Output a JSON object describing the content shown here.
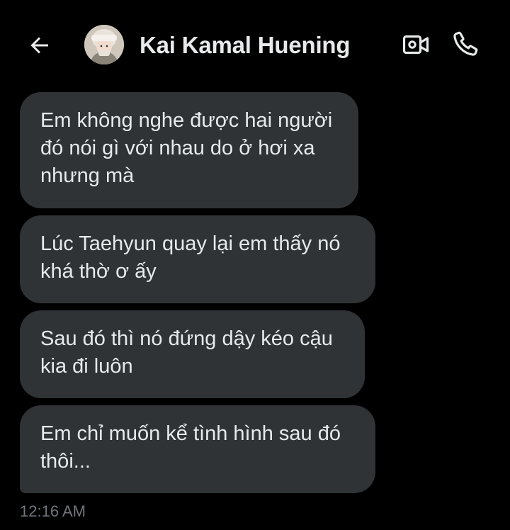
{
  "header": {
    "back_icon": "arrow-left-icon",
    "contact_name": "Kai Kamal Huening",
    "video_icon": "video-camera-icon",
    "call_icon": "phone-icon"
  },
  "messages": [
    {
      "text": "Em không nghe được hai người\nđó nói gì với nhau do ở hơi xa\nnhưng mà"
    },
    {
      "text": "Lúc Taehyun quay lại em thấy nó\nkhá thờ ơ ấy"
    },
    {
      "text": "Sau đó thì nó đứng dậy kéo cậu\nkia đi luôn"
    },
    {
      "text": "Em chỉ muốn kể tình hình sau đó\nthôi..."
    }
  ],
  "timestamp": "12:16 AM",
  "colors": {
    "background": "#000000",
    "bubble": "#2f3336",
    "text": "#e7e9ea",
    "muted": "#71767b"
  }
}
